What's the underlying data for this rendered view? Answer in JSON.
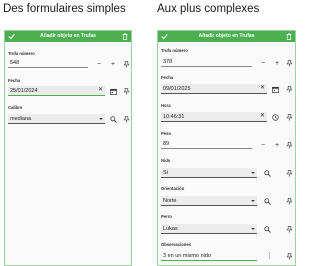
{
  "captions": {
    "left": "Des formulaires simples",
    "right": "Aux plus complexes"
  },
  "left_form": {
    "title": "Añadir objeto en Trufas",
    "fields": [
      {
        "label": "Trufa número",
        "value": "548"
      },
      {
        "label": "Fecha",
        "value": "25/01/2024"
      },
      {
        "label": "Calibre",
        "value": "mediana"
      }
    ]
  },
  "right_form": {
    "title": "Añadir objeto en Trufas",
    "fields": [
      {
        "label": "Trufa número",
        "value": "378"
      },
      {
        "label": "Fecha",
        "value": "09/01/2025"
      },
      {
        "label": "Hora",
        "value": "10:46:31"
      },
      {
        "label": "Peso",
        "value": "89"
      },
      {
        "label": "Nido",
        "value": "Si"
      },
      {
        "label": "Orientación",
        "value": "Norte"
      },
      {
        "label": "Perro",
        "value": "Lukas"
      },
      {
        "label": "Observaciones",
        "value": "3 en un mismo nido"
      }
    ]
  },
  "colors": {
    "accent": "#4caf50",
    "border": "#9cd49f"
  },
  "icons": [
    "check-icon",
    "trash-icon",
    "minus-icon",
    "plus-icon",
    "pin-icon",
    "clear-icon",
    "calendar-icon",
    "clock-icon",
    "search-icon",
    "dropdown-caret-icon",
    "more-vert-icon"
  ]
}
